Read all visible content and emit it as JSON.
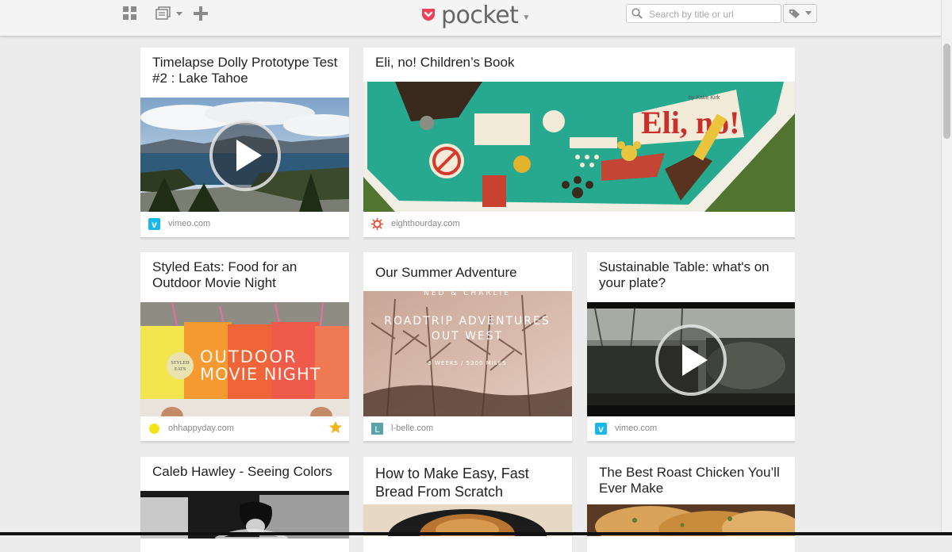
{
  "topbar": {
    "logo_text": "pocket",
    "search_placeholder": "Search by title or url"
  },
  "icons": {
    "grid": "grid-view-icon",
    "list": "list-view-icon",
    "add": "plus-icon",
    "search": "search-icon",
    "tag": "tag-icon"
  },
  "colors": {
    "brand": "#ee4056",
    "vimeo": "#1ab7ea"
  },
  "cards": [
    {
      "title": "Timelapse Dolly Prototype Test #2 : Lake Tahoe",
      "source": "vimeo.com"
    },
    {
      "title": "Eli, no! Children’s Book",
      "source": "eighthourday.com",
      "cover_text": "Eli, no!",
      "cover_byline": "by Katie Kirk"
    },
    {
      "title": "Styled Eats: Food for an Outdoor Movie Night",
      "source": "ohhappyday.com",
      "overlay_line1": "OUTDOOR",
      "overlay_line2": "MOVIE NIGHT",
      "badge_line1": "STYLED",
      "badge_line2": "EATS"
    },
    {
      "title": "Our Summer Adventure",
      "source": "l-belle.com",
      "overlay_top": "NED & CHARLIE",
      "overlay_line1": "ROADTRIP ADVENTURES",
      "overlay_line2": "OUT WEST",
      "overlay_sub": "3 WEEKS / 5300 MILES",
      "favicon_letter": "L"
    },
    {
      "title": "Sustainable Table: what's on your plate?",
      "source": "vimeo.com"
    },
    {
      "title": "Caleb Hawley - Seeing Colors"
    },
    {
      "title": "How to Make Easy, Fast Bread From Scratch"
    },
    {
      "title": "The Best Roast Chicken You’ll Ever Make"
    }
  ]
}
